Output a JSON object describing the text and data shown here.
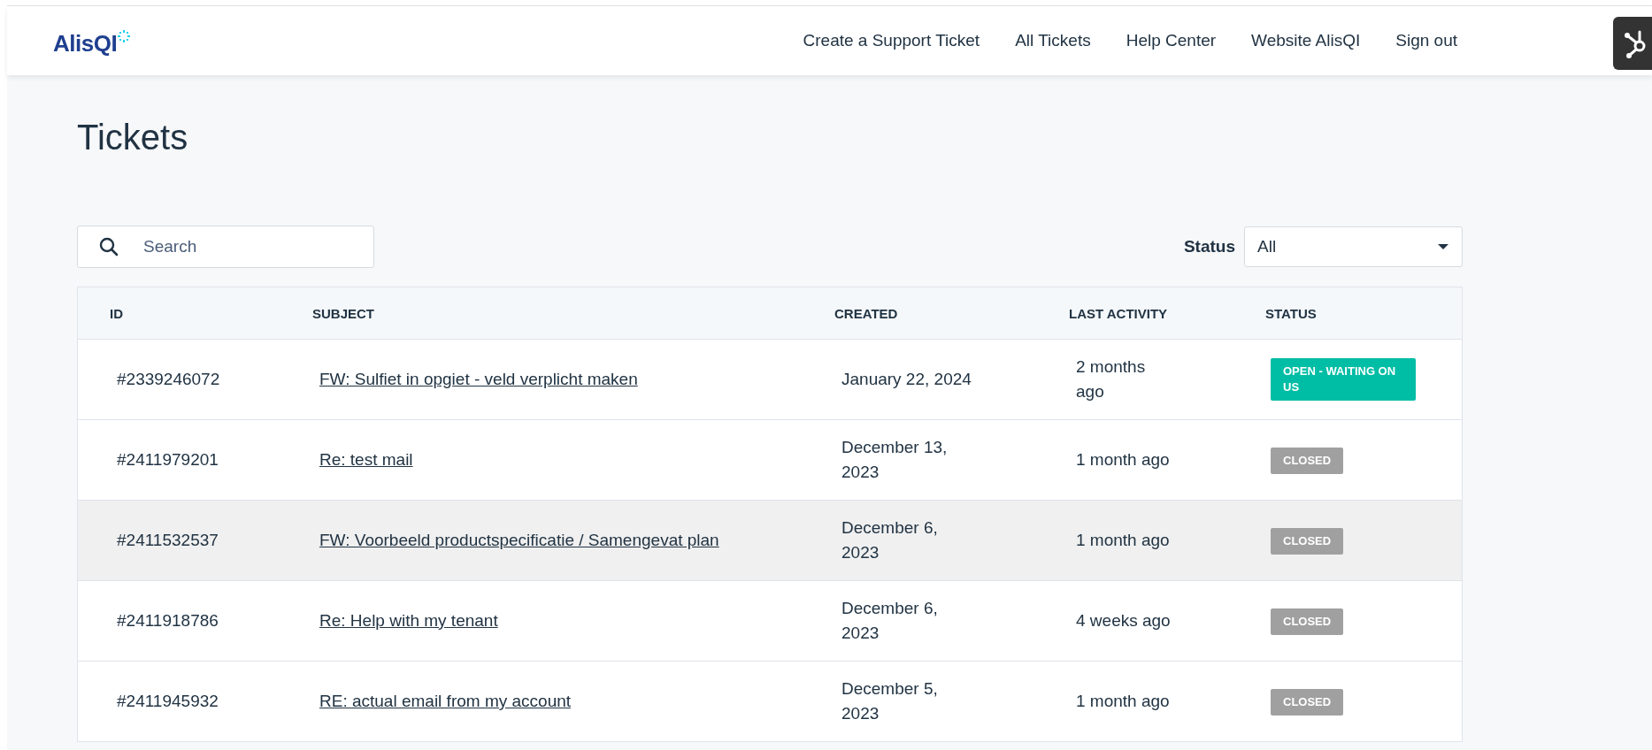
{
  "header": {
    "logo": "AlisQI",
    "nav": [
      {
        "label": "Create a Support Ticket"
      },
      {
        "label": "All Tickets"
      },
      {
        "label": "Help Center"
      },
      {
        "label": "Website AlisQI"
      },
      {
        "label": "Sign out"
      }
    ]
  },
  "page_title": "Tickets",
  "search": {
    "placeholder": "Search"
  },
  "status_filter": {
    "label": "Status",
    "value": "All"
  },
  "table": {
    "columns": [
      "ID",
      "SUBJECT",
      "CREATED",
      "LAST ACTIVITY",
      "STATUS"
    ],
    "rows": [
      {
        "id": "#2339246072",
        "subject": "FW: Sulfiet in opgiet - veld verplicht maken",
        "created": "January 22, 2024",
        "last_activity": "2 months ago",
        "status": "OPEN - WAITING ON US",
        "color": "#00bda5",
        "hovered": false
      },
      {
        "id": "#2411979201",
        "subject": "Re: test mail",
        "created": "December 13, 2023",
        "last_activity": "1 month ago",
        "status": "CLOSED",
        "color": "#a0a0a0",
        "hovered": false
      },
      {
        "id": "#2411532537",
        "subject": "FW: Voorbeeld productspecificatie / Samengevat plan",
        "created": "December 6, 2023",
        "last_activity": "1 month ago",
        "status": "CLOSED",
        "color": "#a0a0a0",
        "hovered": true
      },
      {
        "id": "#2411918786",
        "subject": "Re: Help with my tenant",
        "created": "December 6, 2023",
        "last_activity": "4 weeks ago",
        "status": "CLOSED",
        "color": "#a0a0a0",
        "hovered": false
      },
      {
        "id": "#2411945932",
        "subject": "RE: actual email from my account",
        "created": "December 5, 2023",
        "last_activity": "1 month ago",
        "status": "CLOSED",
        "color": "#a0a0a0",
        "hovered": false
      }
    ]
  }
}
